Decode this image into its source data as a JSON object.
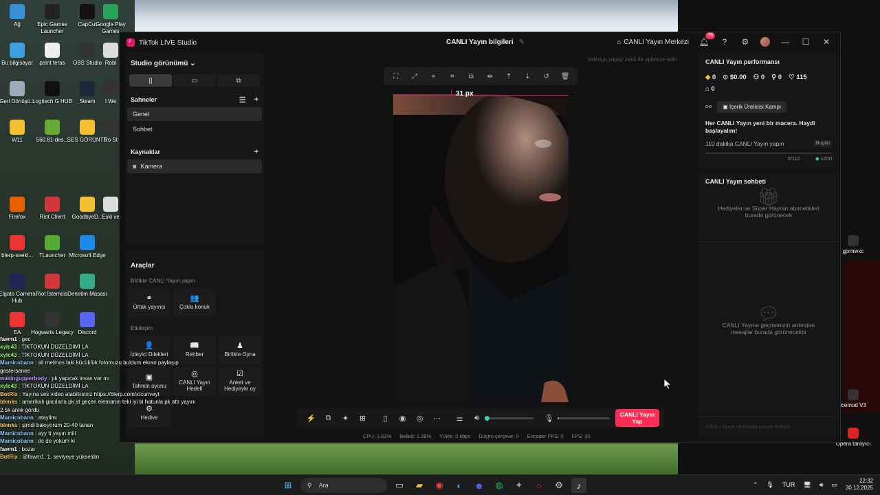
{
  "desktop": {
    "icons": [
      {
        "label": "Ağ",
        "color": "#3a8fd9"
      },
      {
        "label": "Epic Games Launcher",
        "color": "#222"
      },
      {
        "label": "CapCut",
        "color": "#111"
      },
      {
        "label": "Google Play Games",
        "color": "#2aa35a"
      },
      {
        "label": "Bu bilgisayar",
        "color": "#3aa0e0"
      },
      {
        "label": "paint teras",
        "color": "#eee"
      },
      {
        "label": "OBS Studio",
        "color": "#333"
      },
      {
        "label": "Robl",
        "color": "#ddd"
      },
      {
        "label": "Geri Dönüşü...",
        "color": "#9ab"
      },
      {
        "label": "Logitech G HUB",
        "color": "#111"
      },
      {
        "label": "Steam",
        "color": "#1b2838"
      },
      {
        "label": "I We",
        "color": "#333"
      },
      {
        "label": "W11",
        "color": "#f0c030"
      },
      {
        "label": "560.81-des...",
        "color": "#6a3"
      },
      {
        "label": "SES GÖRÜNTÜ",
        "color": "#f0c030"
      },
      {
        "label": "Ro St",
        "color": "#333"
      },
      {
        "label": "Firefox",
        "color": "#e66000"
      },
      {
        "label": "Riot Client",
        "color": "#d13639"
      },
      {
        "label": "GoodbyeD...",
        "color": "#f0c030"
      },
      {
        "label": "Eski ve",
        "color": "#ddd"
      },
      {
        "label": "blerp-seekl...",
        "color": "#e33"
      },
      {
        "label": "TLauncher",
        "color": "#5a3"
      },
      {
        "label": "Microsoft Edge",
        "color": "#1e88e5"
      },
      {
        "label": "Elgato Camera Hub",
        "color": "#225"
      },
      {
        "label": "Riot İstemcisi",
        "color": "#d13639"
      },
      {
        "label": "Denetim Masası",
        "color": "#3a8"
      },
      {
        "label": "EA",
        "color": "#e33"
      },
      {
        "label": "Hogwarts Legacy",
        "color": "#333"
      },
      {
        "label": "Discord",
        "color": "#5865f2"
      }
    ],
    "right_icons": [
      {
        "label": "gjxmwxc"
      },
      {
        "label": "icemod V3"
      },
      {
        "label": "Opera tarayıcı"
      }
    ]
  },
  "chat_overlay": [
    {
      "user": "fawm1",
      "text": " : gec",
      "color": "#fff"
    },
    {
      "user": "xylc43",
      "text": " : TİKTOKUN DÜZELDİMİ LA",
      "color": "#9f6"
    },
    {
      "user": "xylc43",
      "text": " : TİKTOKUN DÜZELDİMİ LA",
      "color": "#9f6"
    },
    {
      "user": "Mamicobann",
      "text": " : ali metinos taki kücüklük fotomuzu buldum ekran paylaşıp gostersenee",
      "color": "#9cf"
    },
    {
      "user": "wakingupperbody",
      "text": " : pk yapıcak insan var mı",
      "color": "#c9f"
    },
    {
      "user": "xylc43",
      "text": " : TİKTOKUN DÜZELDİMİ LA",
      "color": "#9f6"
    },
    {
      "user": "BotRix",
      "text": " : Yayına ses video atabilirsiniz https://blerp.com/x/cunveyt",
      "color": "#fc6"
    },
    {
      "user": "blenks",
      "text": " : amerikalı gacılarla pk at geçen elemanın teki iyi bi hatunla pk attı yayını 2.5k anlık gördü",
      "color": "#fc6"
    },
    {
      "user": "Mamicobann",
      "text": " : ataylimi",
      "color": "#9cf"
    },
    {
      "user": "blenks",
      "text": " : şimdi bakıyorum 20-40 tanan",
      "color": "#fc6"
    },
    {
      "user": "Mamicobann",
      "text": " : ayy tt yayın miii",
      "color": "#9cf"
    },
    {
      "user": "Mamicobann",
      "text": " : dc de yokum ki",
      "color": "#9cf"
    },
    {
      "user": "fawm1",
      "text": " : bozar",
      "color": "#fff"
    },
    {
      "user": "BotRix",
      "text": " : @fawm1, 1. seviyeye yükseldin",
      "color": "#fc6"
    }
  ],
  "app": {
    "title": "TikTok LIVE Studio",
    "center_title": "CANLI Yayın bilgileri",
    "live_center": "CANLI Yayın Merkezi",
    "notif_count": "36"
  },
  "left": {
    "studio_view": "Studio görünümü",
    "scenes_label": "Sahneler",
    "scenes": [
      "Genel",
      "Sohbet"
    ],
    "sources_label": "Kaynaklar",
    "sources": [
      "Kamera"
    ],
    "tools_label": "Araçlar",
    "collab_label": "Birlikte CANLI Yayın yapın",
    "collab_tools": [
      {
        "icon": "⚭",
        "label": "Ortak yayıncı"
      },
      {
        "icon": "👥",
        "label": "Çoklu konuk"
      }
    ],
    "engage_label": "Etkileşim",
    "engage_tools": [
      {
        "icon": "👤",
        "label": "İzleyici Dilekleri"
      },
      {
        "icon": "📖",
        "label": "Rehber"
      },
      {
        "icon": "♟",
        "label": "Birlikte Oyna"
      },
      {
        "icon": "▣",
        "label": "Tahmin oyunu"
      },
      {
        "icon": "◎",
        "label": "CANLI Yayın Hedefi"
      },
      {
        "icon": "☑",
        "label": "Anket ve Hediyeyle oy"
      },
      {
        "icon": "⚙",
        "label": "Hedive"
      }
    ]
  },
  "preview": {
    "hint": "Videoyu yapay zekâ ile optimize edin",
    "px_label": "31 px"
  },
  "controls": {
    "go_live": "CANLI Yayın Yap",
    "volume_level": 0.03,
    "mic_level": 0.02
  },
  "stats": {
    "cpu": "CPU: 1.63%",
    "memory": "Bellek: 1.39%",
    "upload": "Yükle: 0 kbps",
    "dropped": "Düşen çerçeve: 0",
    "encoder": "Encoder FPS: 0",
    "fps": "FPS: 30"
  },
  "right": {
    "perf_title": "CANLI Yayın performansı",
    "stat_diamonds": "0",
    "stat_money": "$0.00",
    "stat_viewers": "0",
    "stat_followers": "0",
    "stat_likes": "115",
    "stat_gifts": "0",
    "camp_btn": "İçerik Üreticisi Kampı",
    "adv_title": "Her CANLI Yayın yeni bir macera. Haydi başlayalım!",
    "mission": "110 dakika CANLI Yayın yapın",
    "today": "Bugün",
    "progress_text": "0/110",
    "reward": "x200",
    "chat_title": "CANLI Yayın sohbeti",
    "empty_gifts": "Hediyeler ve Süper Hayran abonelikleri burada görünecek",
    "empty_chat": "CANLI Yayına geçmenizin ardından mesajlar burada görünecektir",
    "chat_placeholder": "CANLI Yayın sırasında yorum ekleyin"
  },
  "taskbar": {
    "search": "Ara",
    "lang": "TUR",
    "time": "22:32",
    "date": "30.12.2025"
  }
}
